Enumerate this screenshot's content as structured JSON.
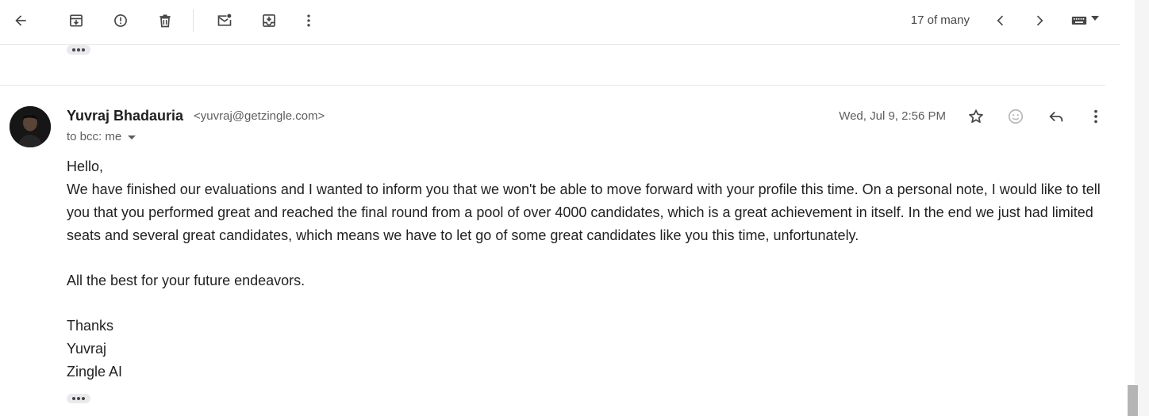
{
  "toolbar": {
    "buttons": [
      {
        "icon": "arrow-back-icon",
        "label": "Back to Inbox"
      },
      {
        "icon": "archive-icon",
        "label": "Archive"
      },
      {
        "icon": "report-spam-icon",
        "label": "Report spam"
      },
      {
        "icon": "delete-icon",
        "label": "Delete"
      },
      {
        "icon": "mark-unread-icon",
        "label": "Mark as unread"
      },
      {
        "icon": "move-to-icon",
        "label": "Move to"
      },
      {
        "icon": "more-vert-icon",
        "label": "More"
      }
    ],
    "counter": "17 of many",
    "nav": [
      {
        "icon": "chevron-left-icon",
        "label": "Newer"
      },
      {
        "icon": "chevron-right-icon",
        "label": "Older"
      }
    ],
    "input_tools_icon": "keyboard-icon"
  },
  "message": {
    "sender_name": "Yuvraj Bhadauria",
    "sender_email": "<yuvraj@getzingle.com>",
    "recipients": "to bcc: me",
    "date": "Wed, Jul 9, 2:56 PM",
    "actions": [
      {
        "icon": "star-icon",
        "label": "Star"
      },
      {
        "icon": "emoji-icon",
        "label": "Add reaction"
      },
      {
        "icon": "reply-icon",
        "label": "Reply"
      },
      {
        "icon": "more-vert-icon",
        "label": "More"
      }
    ],
    "body": {
      "greeting": "Hello,",
      "paragraph": "We have finished our evaluations and I wanted to inform you that we won't be able to move forward with your profile this time. On a personal note, I would like to tell you that you performed great and reached the final round from a pool of over 4000 candidates, which is a great achievement in itself. In the end we just had limited seats and several great candidates, which means we have to let go of some great candidates like you this time, unfortunately.",
      "wishes": "All the best for your future endeavors.",
      "signoff": "Thanks",
      "signature_name": "Yuvraj",
      "signature_company": "Zingle AI"
    }
  },
  "colors": {
    "icon": "#444746",
    "text_primary": "#1f1f1f",
    "text_secondary": "#5e5e5e",
    "divider": "#e6e6e6",
    "chip": "#e8eaed"
  }
}
